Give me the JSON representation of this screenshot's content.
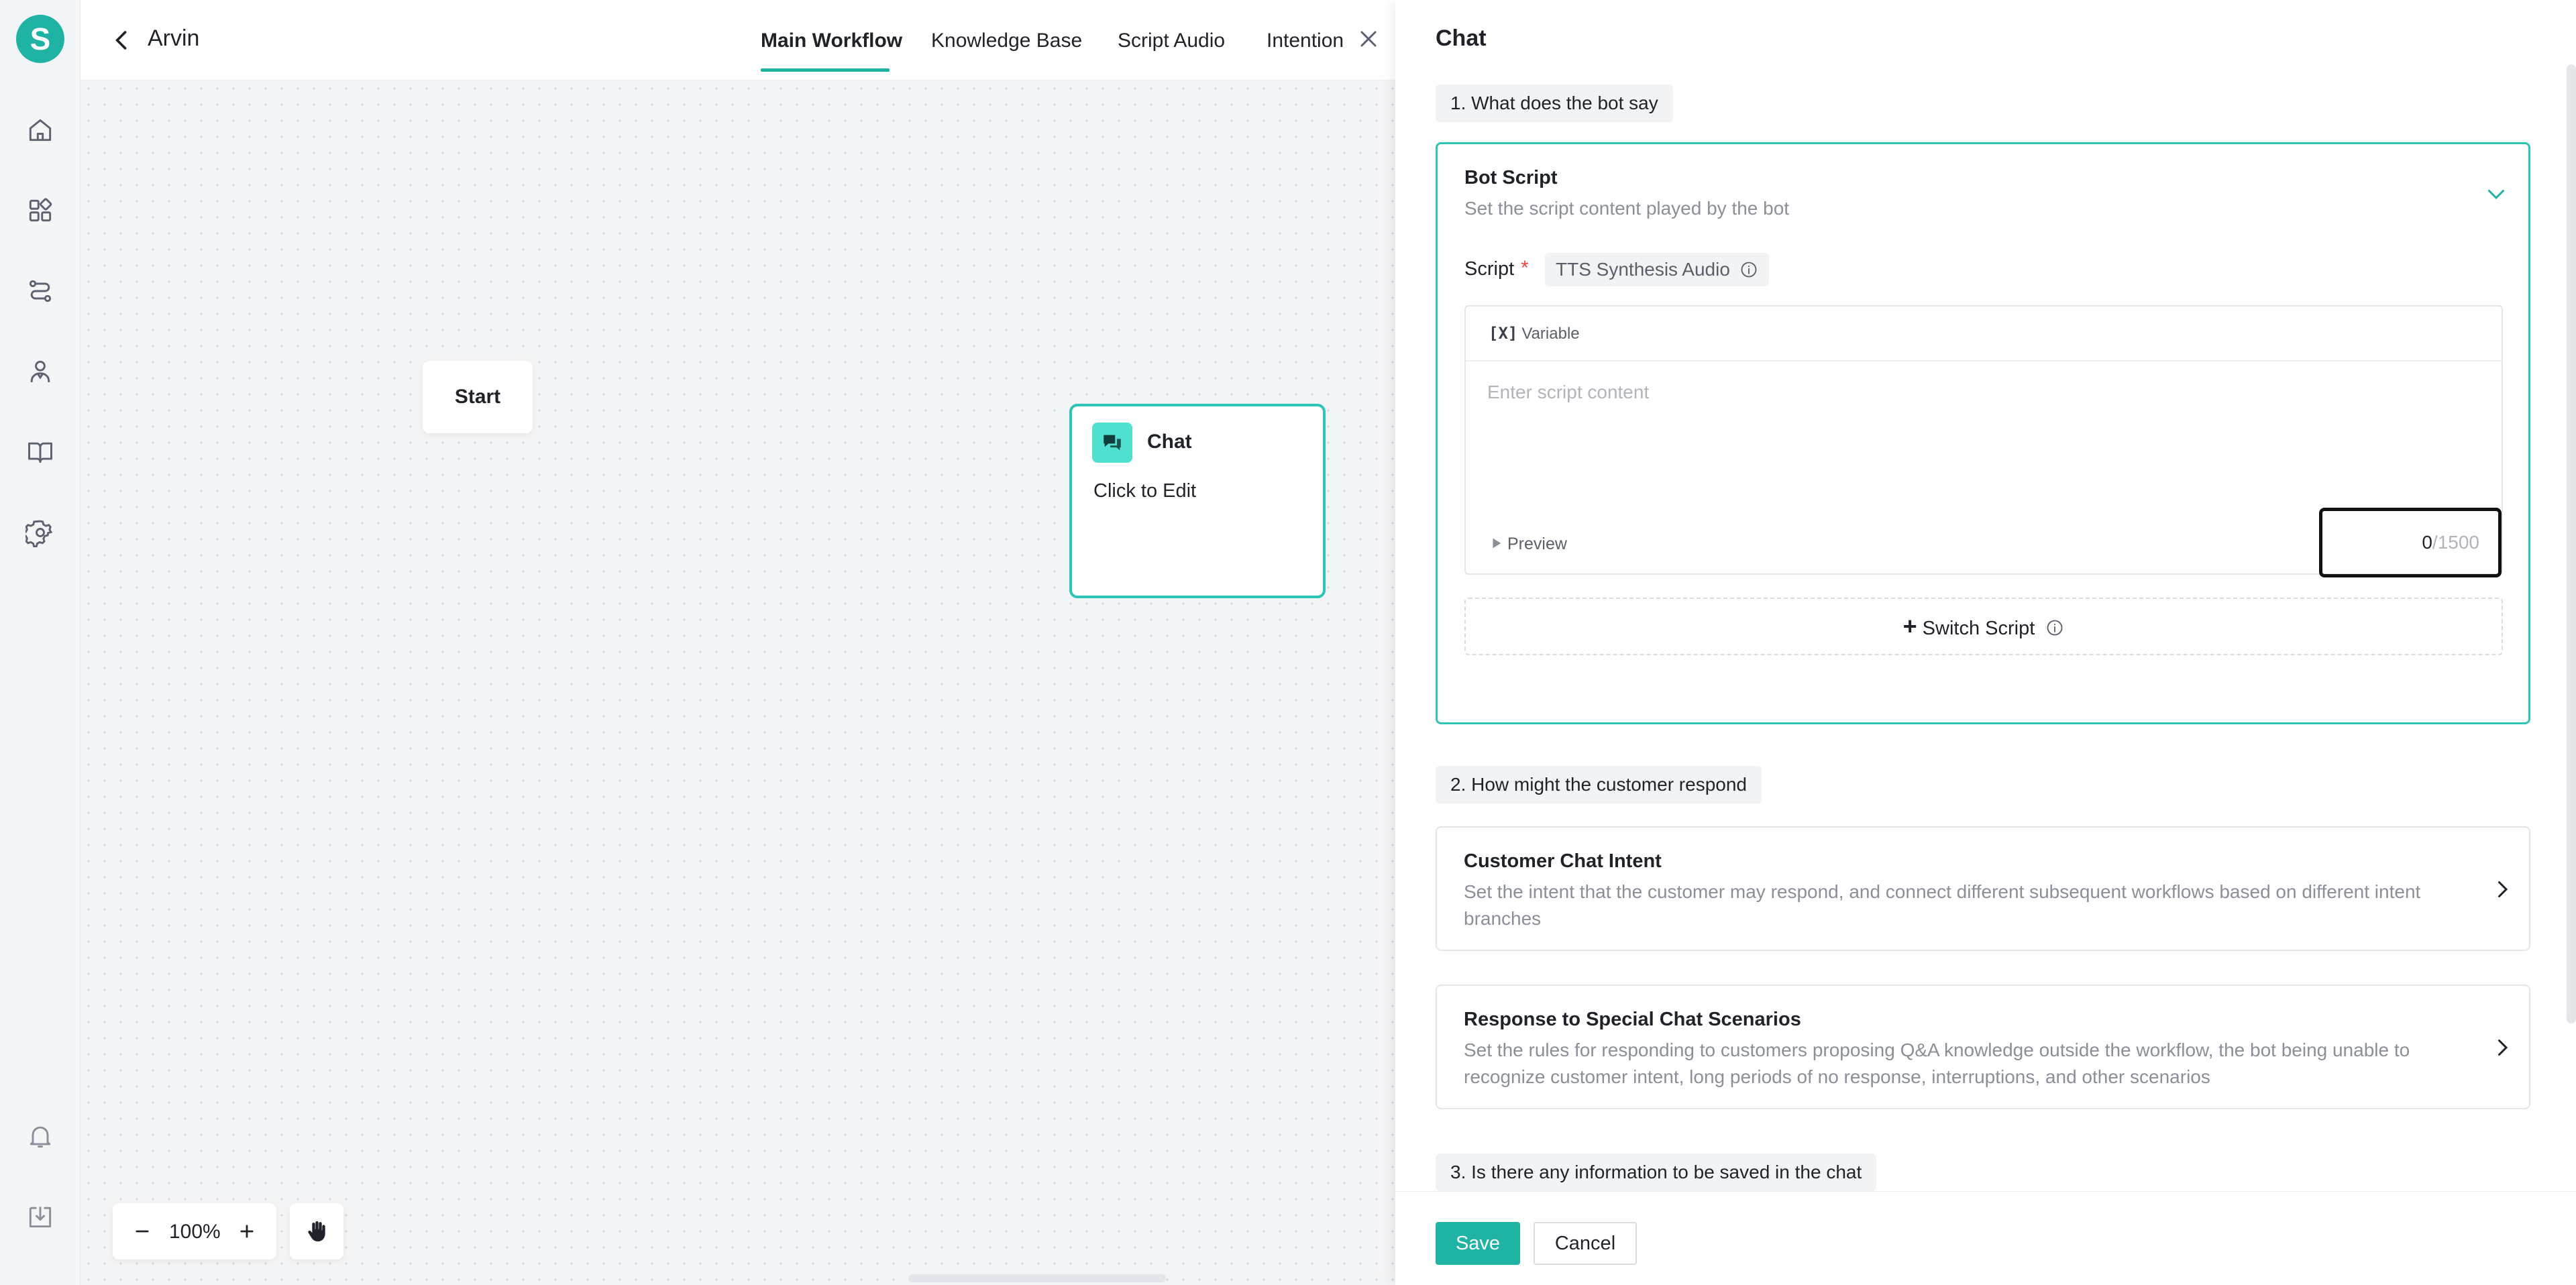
{
  "header": {
    "flow_name": "Arvin",
    "tabs": [
      {
        "label": "Main Workflow",
        "active": true
      },
      {
        "label": "Knowledge Base",
        "active": false
      },
      {
        "label": "Script Audio",
        "active": false
      },
      {
        "label": "Intention",
        "active": false
      }
    ]
  },
  "nav": {
    "logo_letter": "S",
    "items": [
      "home-icon",
      "apps-icon",
      "workflow-icon",
      "agent-icon",
      "book-icon",
      "settings-icon"
    ],
    "bottom_items": [
      "bell-icon",
      "download-icon"
    ]
  },
  "canvas": {
    "start_node": {
      "label": "Start"
    },
    "chat_node": {
      "title": "Chat",
      "subtitle": "Click to Edit"
    },
    "zoom": "100%",
    "zoom_minus": "−",
    "zoom_plus": "+"
  },
  "drawer": {
    "title": "Chat",
    "section1": "1. What does the bot say",
    "bot_script": {
      "title": "Bot Script",
      "description": "Set the script content played by the bot",
      "script_label": "Script",
      "required_mark": "*",
      "tts_tag": "TTS Synthesis Audio",
      "variable_button": "Variable",
      "variable_glyph": "[X]",
      "placeholder": "Enter script content",
      "preview_label": "Preview",
      "char_count": "0",
      "char_limit": "/1500",
      "switch_script": "Switch Script"
    },
    "section2": "2. How might the customer respond",
    "intent_card": {
      "title": "Customer Chat Intent",
      "description": "Set the intent that the customer may respond, and connect different subsequent workflows based on different intent branches"
    },
    "special_card": {
      "title": "Response to Special Chat Scenarios",
      "description": "Set the rules for responding to customers proposing Q&A knowledge outside the workflow, the bot being unable to recognize customer intent, long periods of no response, interruptions, and other scenarios"
    },
    "section3": "3. Is there any information to be saved in the chat",
    "save_label": "Save",
    "cancel_label": "Cancel"
  },
  "colors": {
    "accent": "#1fb3a3",
    "node_border": "#2ec4b6",
    "required": "#f04848"
  }
}
